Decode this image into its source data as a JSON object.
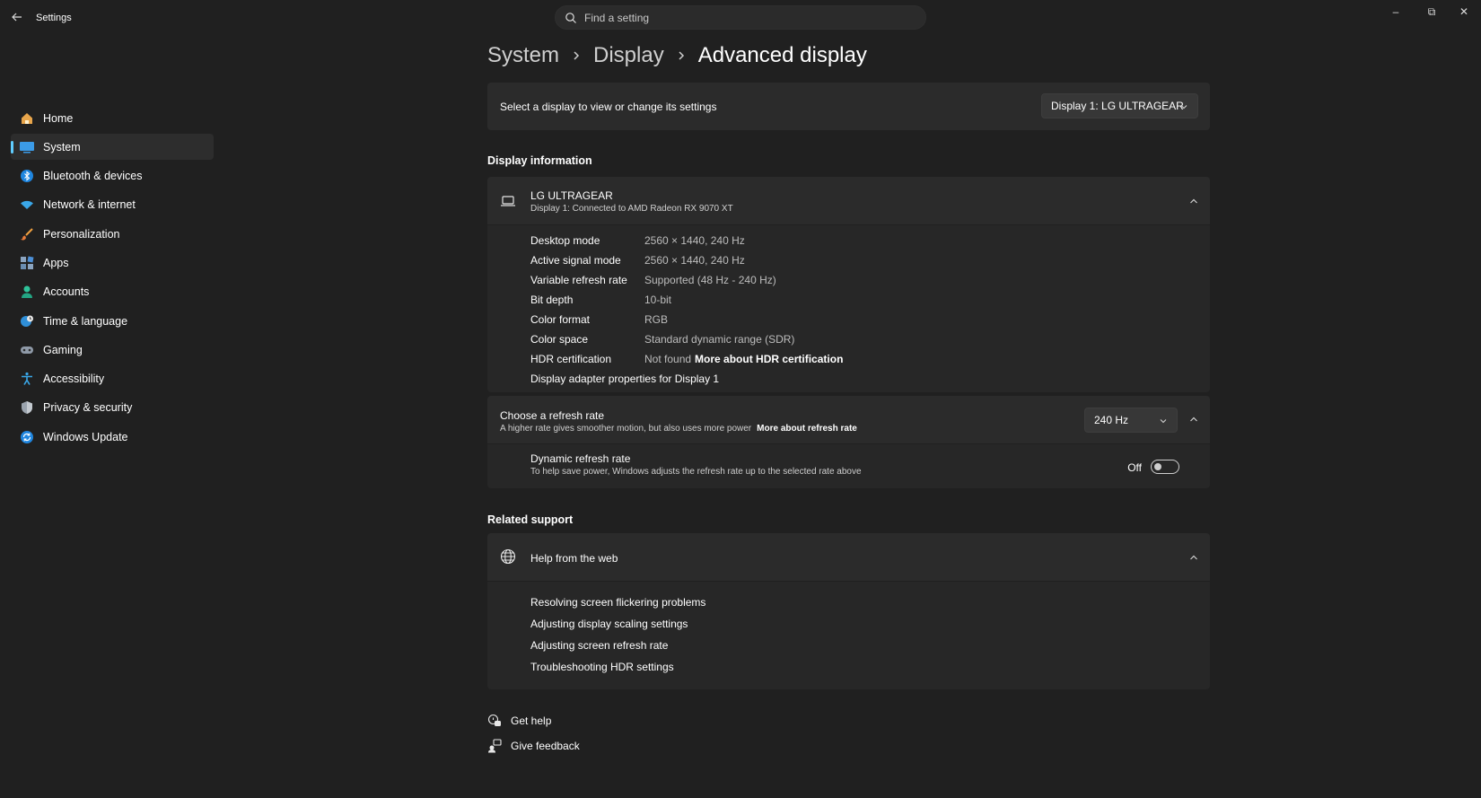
{
  "window": {
    "title": "Settings",
    "controls": {
      "minimize": "–",
      "restore": "⧉",
      "close": "✕"
    }
  },
  "search": {
    "placeholder": "Find a setting"
  },
  "sidebar": {
    "items": [
      {
        "label": "Home",
        "icon": "home-icon"
      },
      {
        "label": "System",
        "icon": "system-icon",
        "active": true
      },
      {
        "label": "Bluetooth & devices",
        "icon": "bluetooth-icon"
      },
      {
        "label": "Network & internet",
        "icon": "wifi-icon"
      },
      {
        "label": "Personalization",
        "icon": "brush-icon"
      },
      {
        "label": "Apps",
        "icon": "apps-icon"
      },
      {
        "label": "Accounts",
        "icon": "person-icon"
      },
      {
        "label": "Time & language",
        "icon": "globe-clock-icon"
      },
      {
        "label": "Gaming",
        "icon": "gamepad-icon"
      },
      {
        "label": "Accessibility",
        "icon": "accessibility-icon"
      },
      {
        "label": "Privacy & security",
        "icon": "shield-icon"
      },
      {
        "label": "Windows Update",
        "icon": "update-icon"
      }
    ]
  },
  "breadcrumb": {
    "items": [
      "System",
      "Display",
      "Advanced display"
    ]
  },
  "display_select": {
    "text": "Select a display to view or change its settings",
    "value": "Display 1: LG ULTRAGEAR"
  },
  "display_info": {
    "section_title": "Display information",
    "monitor_name": "LG ULTRAGEAR",
    "monitor_sub": "Display 1: Connected to AMD Radeon RX 9070 XT",
    "rows": [
      {
        "key": "Desktop mode",
        "value": "2560 × 1440, 240 Hz"
      },
      {
        "key": "Active signal mode",
        "value": "2560 × 1440, 240 Hz"
      },
      {
        "key": "Variable refresh rate",
        "value": "Supported (48 Hz - 240 Hz)"
      },
      {
        "key": "Bit depth",
        "value": "10-bit"
      },
      {
        "key": "Color format",
        "value": "RGB"
      },
      {
        "key": "Color space",
        "value": "Standard dynamic range (SDR)"
      },
      {
        "key": "HDR certification",
        "value": "Not found",
        "link": "More about HDR certification"
      }
    ],
    "adapter_link": "Display adapter properties for Display 1"
  },
  "refresh": {
    "title": "Choose a refresh rate",
    "sub": "A higher rate gives smoother motion, but also uses more power",
    "sub_link": "More about refresh rate",
    "value": "240 Hz",
    "dynamic_title": "Dynamic refresh rate",
    "dynamic_sub": "To help save power, Windows adjusts the refresh rate up to the selected rate above",
    "dynamic_state": "Off"
  },
  "support": {
    "section_title": "Related support",
    "help_title": "Help from the web",
    "links": [
      "Resolving screen flickering problems",
      "Adjusting display scaling settings",
      "Adjusting screen refresh rate",
      "Troubleshooting HDR settings"
    ]
  },
  "footer": {
    "get_help": "Get help",
    "give_feedback": "Give feedback"
  },
  "colors": {
    "accent": "#60cdff",
    "background": "#202020",
    "card": "#2b2b2b"
  }
}
